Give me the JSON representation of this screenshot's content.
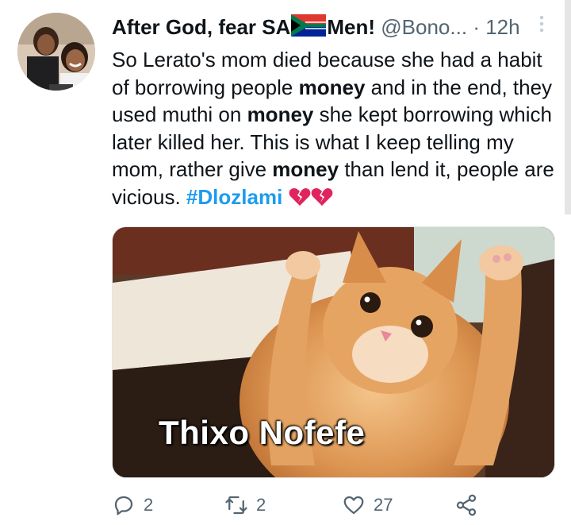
{
  "header": {
    "display_name_part1": "After God, fear SA",
    "display_name_part2": "Men!",
    "handle": "@Bono...",
    "separator": "·",
    "time": "12h"
  },
  "tweet": {
    "text_segments": [
      {
        "text": "So Lerato's mom died because she had a habit of borrowing people ",
        "bold": false
      },
      {
        "text": "money",
        "bold": true
      },
      {
        "text": " and in the end, they used muthi on ",
        "bold": false
      },
      {
        "text": "money",
        "bold": true
      },
      {
        "text": " she kept borrowing which later killed her. This is what I keep telling my mom, rather give ",
        "bold": false
      },
      {
        "text": "money",
        "bold": true
      },
      {
        "text": " than lend it, people are vicious. ",
        "bold": false
      }
    ],
    "hashtag": "#Dlozlami"
  },
  "media": {
    "caption": "Thixo Nofefe"
  },
  "actions": {
    "reply_count": "2",
    "retweet_count": "2",
    "like_count": "27"
  },
  "colors": {
    "accent": "#1d9bf0",
    "muted": "#536471",
    "broken_heart": "#e0245e"
  }
}
